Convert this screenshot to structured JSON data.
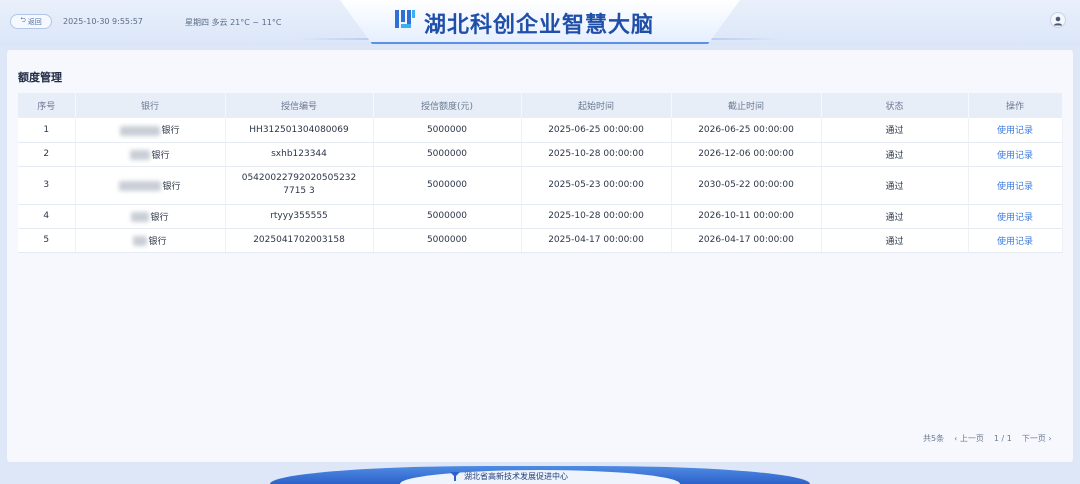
{
  "header": {
    "back_label": "返回",
    "datetime": "2025-10-30  9:55:57",
    "weather": "星期四  多云  21°C ~ 11°C",
    "app_title": "湖北科创企业智慧大脑"
  },
  "page": {
    "section_title": "额度管理"
  },
  "table": {
    "columns": [
      "序号",
      "银行",
      "授信编号",
      "授信额度(元)",
      "起始时间",
      "截止时间",
      "状态",
      "操作"
    ],
    "rows": [
      {
        "index": "1",
        "bank": "银行",
        "credit_no": "HH312501304080069",
        "amount": "5000000",
        "start": "2025-06-25 00:00:00",
        "end": "2026-06-25 00:00:00",
        "status": "通过",
        "action": "使用记录"
      },
      {
        "index": "2",
        "bank": "银行",
        "credit_no": "sxhb123344",
        "amount": "5000000",
        "start": "2025-10-28 00:00:00",
        "end": "2026-12-06 00:00:00",
        "status": "通过",
        "action": "使用记录"
      },
      {
        "index": "3",
        "bank": "银行",
        "credit_no": "054200227920205052327715 3",
        "amount": "5000000",
        "start": "2025-05-23 00:00:00",
        "end": "2030-05-22 00:00:00",
        "status": "通过",
        "action": "使用记录"
      },
      {
        "index": "4",
        "bank": "银行",
        "credit_no": "rtyyy355555",
        "amount": "5000000",
        "start": "2025-10-28 00:00:00",
        "end": "2026-10-11 00:00:00",
        "status": "通过",
        "action": "使用记录"
      },
      {
        "index": "5",
        "bank": "银行",
        "credit_no": "2025041702003158",
        "amount": "5000000",
        "start": "2025-04-17 00:00:00",
        "end": "2026-04-17 00:00:00",
        "status": "通过",
        "action": "使用记录"
      }
    ]
  },
  "pagination": {
    "total": "共5条",
    "prev": "‹ 上一页",
    "page": "1 / 1",
    "next": "下一页 ›"
  },
  "footer": {
    "org_name": "湖北省高新技术发展促进中心"
  },
  "colors": {
    "accent": "#1f4fa8",
    "link": "#3a7bde",
    "footer_band": "#2d62c9"
  }
}
